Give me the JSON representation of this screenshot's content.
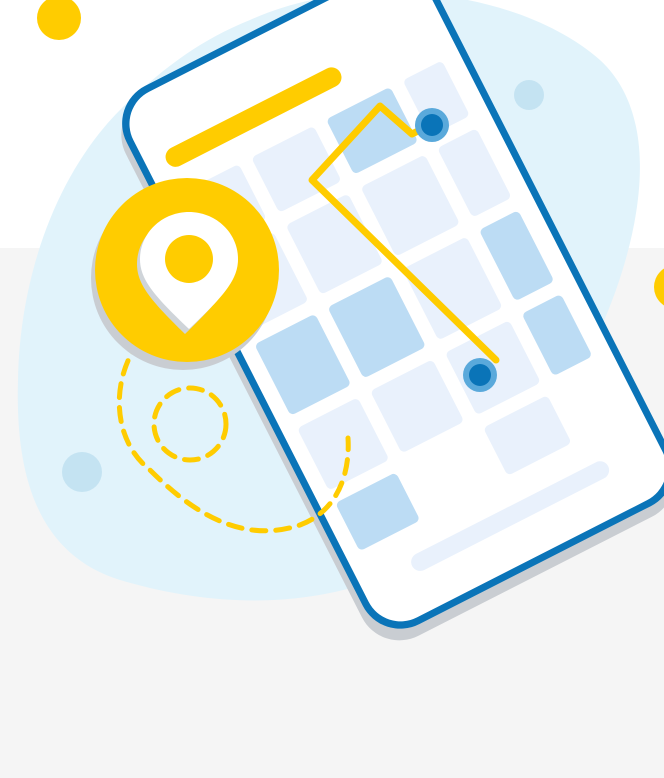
{
  "colors": {
    "background_top": "#ffffff",
    "background_bottom": "#f5f5f5",
    "blob": "#e1f3fb",
    "bubble": "#c4e3f2",
    "phone_frame": "#0a74b8",
    "phone_screen": "#ffffff",
    "shadow": "#c9cdd2",
    "map_block_light": "#e9f1fc",
    "map_block_dark": "#bcdcf4",
    "accent_yellow": "#ffcc00",
    "route_dot": "#0a74b8",
    "route_dot_halo": "#5aa9db",
    "pin_body": "#ffffff",
    "pin_hole": "#ffcc00",
    "pin_shadow": "#cfd4d9"
  },
  "icons": {
    "location_pin": "map-pin-icon",
    "route_start": "route-start-dot-icon",
    "route_end": "route-end-dot-icon"
  }
}
